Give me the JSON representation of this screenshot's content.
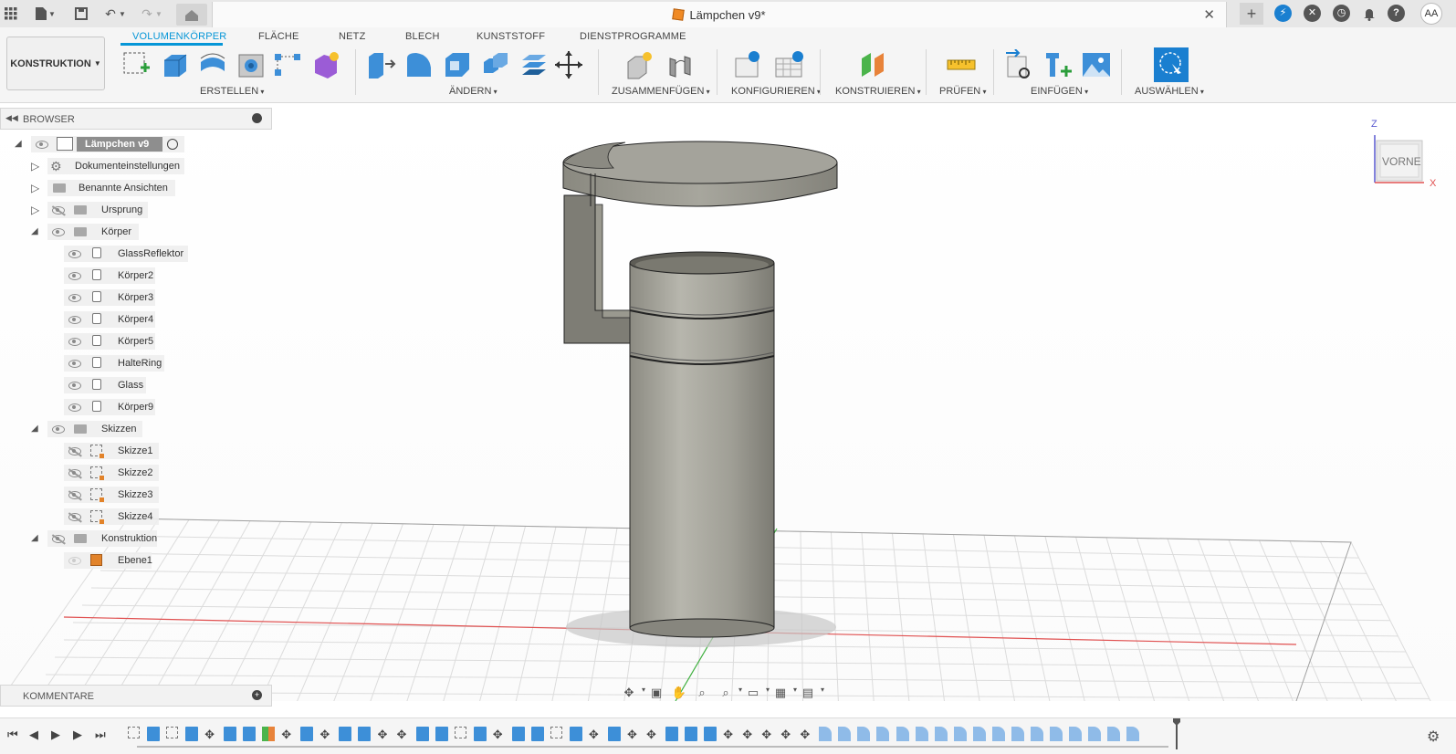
{
  "titlebar": {
    "document_title": "Lämpchen v9*",
    "close_glyph": "✕",
    "avatar_initials": "AA",
    "icons": [
      "grid-icon",
      "file-icon",
      "save-icon",
      "undo-icon",
      "redo-icon",
      "home-icon",
      "plus-icon",
      "extension-icon",
      "close-circle-icon",
      "clock-icon",
      "bell-icon",
      "help-icon"
    ]
  },
  "ribbon": {
    "workspace": "KONSTRUKTION",
    "tabs": [
      "VOLUMENKÖRPER",
      "FLÄCHE",
      "NETZ",
      "BLECH",
      "KUNSTSTOFF",
      "DIENSTPROGRAMME"
    ],
    "groups": [
      "ERSTELLEN",
      "ÄNDERN",
      "ZUSAMMENFÜGEN",
      "KONFIGURIEREN",
      "KONSTRUIEREN",
      "PRÜFEN",
      "EINFÜGEN",
      "AUSWÄHLEN"
    ]
  },
  "browser": {
    "title": "BROWSER",
    "root": "Lämpchen v9",
    "items": [
      {
        "label": "Dokumenteinstellungen",
        "type": "settings"
      },
      {
        "label": "Benannte Ansichten",
        "type": "folder"
      },
      {
        "label": "Ursprung",
        "type": "folder"
      },
      {
        "label": "Körper",
        "type": "folder"
      },
      {
        "label": "GlassReflektor",
        "type": "body"
      },
      {
        "label": "Körper2",
        "type": "body"
      },
      {
        "label": "Körper3",
        "type": "body"
      },
      {
        "label": "Körper4",
        "type": "body"
      },
      {
        "label": "Körper5",
        "type": "body"
      },
      {
        "label": "HalteRing",
        "type": "body"
      },
      {
        "label": "Glass",
        "type": "body"
      },
      {
        "label": "Körper9",
        "type": "body"
      },
      {
        "label": "Skizzen",
        "type": "folder"
      },
      {
        "label": "Skizze1",
        "type": "sketch"
      },
      {
        "label": "Skizze2",
        "type": "sketch"
      },
      {
        "label": "Skizze3",
        "type": "sketch"
      },
      {
        "label": "Skizze4",
        "type": "sketch"
      },
      {
        "label": "Konstruktion",
        "type": "folder"
      },
      {
        "label": "Ebene1",
        "type": "plane"
      }
    ]
  },
  "comments": {
    "title": "KOMMENTARE"
  },
  "viewcube": {
    "face": "VORNE",
    "axis_z": "Z",
    "axis_x": "X"
  },
  "colors": {
    "accent": "#0696d7",
    "body": "#a3a298",
    "grid": "#d8d8d8",
    "x_axis": "#e05050",
    "y_axis": "#40b040"
  }
}
